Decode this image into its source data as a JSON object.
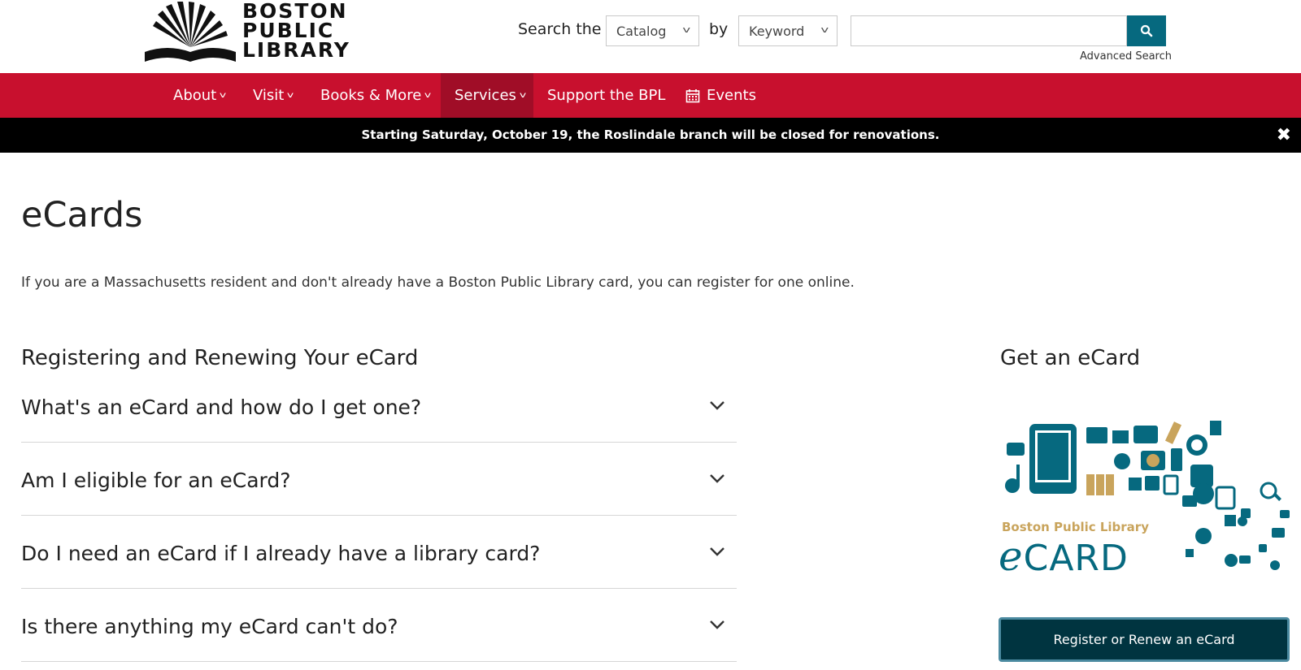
{
  "header": {
    "logo_text": [
      "BOSTON",
      "PUBLIC",
      "LIBRARY"
    ],
    "search_label": "Search the",
    "by_label": "by",
    "scope_select": {
      "value": "Catalog"
    },
    "field_select": {
      "value": "Keyword"
    },
    "search_input": {
      "value": "",
      "placeholder": ""
    },
    "advanced_search": "Advanced Search"
  },
  "nav": {
    "items": [
      {
        "label": "About",
        "dropdown": true
      },
      {
        "label": "Visit",
        "dropdown": true
      },
      {
        "label": "Books & More",
        "dropdown": true
      },
      {
        "label": "Services",
        "dropdown": true,
        "active": true
      },
      {
        "label": "Support the BPL",
        "dropdown": false
      },
      {
        "label": "Events",
        "icon": "calendar-icon",
        "dropdown": false
      }
    ]
  },
  "alert": {
    "text": "Starting Saturday, October 19, the Roslindale branch will be closed for renovations.",
    "close": "✖"
  },
  "main": {
    "title": "eCards",
    "intro": "If you are a Massachusetts resident and don't already have a Boston Public Library card, you can register for one online.",
    "section_heading": "Registering and Renewing Your eCard",
    "faqs": [
      {
        "question": "What's an eCard and how do I get one?"
      },
      {
        "question": "Am I eligible for an eCard?"
      },
      {
        "question": "Do I need an eCard if I already have a library card?"
      },
      {
        "question": "Is there anything my eCard can't do?"
      }
    ]
  },
  "sidebar": {
    "heading": "Get an eCard",
    "image_brand": "Boston Public Library",
    "image_word_e": "e",
    "image_word_rest": "CARD",
    "register_button": "Register or Renew an eCard"
  },
  "colors": {
    "nav_red": "#c8102e",
    "nav_active": "#a00d27",
    "teal": "#06697f",
    "dark_button": "#003440",
    "gold": "#c9a45c"
  }
}
